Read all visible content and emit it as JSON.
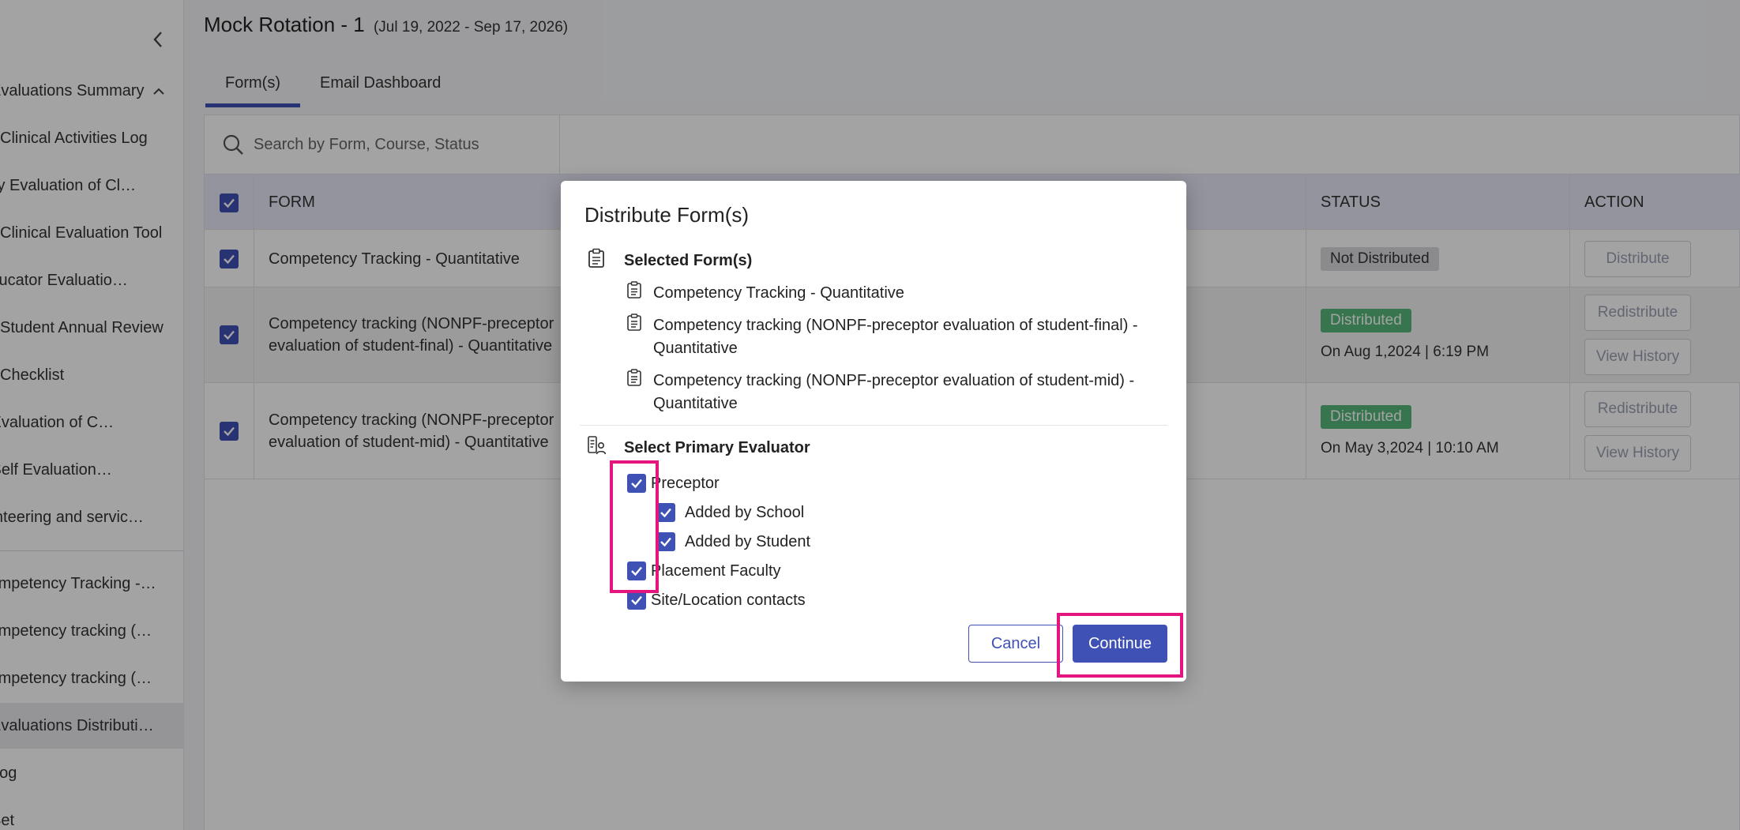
{
  "sidebar": {
    "items": [
      {
        "label": "Evaluations Summary"
      },
      {
        "label": "Clinical Activities Log"
      },
      {
        "label": "Faculty Evaluation of Clinical Site"
      },
      {
        "label": "Clinical Evaluation Tool"
      },
      {
        "label": "Site Educator Evaluation of Student"
      },
      {
        "label": "Student Annual Review"
      },
      {
        "label": "Checklist"
      },
      {
        "label": "Student Evaluation of Course"
      },
      {
        "label": "Student Self Evaluation: Progress"
      },
      {
        "label": "Volunteering and service learning"
      },
      {
        "label": "Competency Tracking - Quantitative"
      },
      {
        "label": "Competency tracking (NONPF-preceptor evaluation of student-final)"
      },
      {
        "label": "Competency tracking (NONPF-preceptor evaluation of student-mid)"
      },
      {
        "label": "Evaluations Distribution"
      },
      {
        "label": "Log"
      },
      {
        "label": "Set"
      }
    ]
  },
  "header": {
    "title": "Mock Rotation - 1",
    "date_range": "(Jul 19, 2022 - Sep 17, 2026)"
  },
  "tabs": [
    {
      "label": "Form(s)"
    },
    {
      "label": "Email Dashboard"
    }
  ],
  "search": {
    "placeholder": "Search by Form, Course, Status"
  },
  "table": {
    "columns": {
      "form": "FORM",
      "status": "STATUS",
      "action": "ACTION"
    },
    "rows": [
      {
        "form": "Competency Tracking - Quantitative",
        "status": "Not Distributed",
        "status_time": "",
        "actions": [
          "Distribute"
        ]
      },
      {
        "form": "Competency tracking (NONPF-preceptor evaluation of student-final) - Quantitative",
        "status": "Distributed",
        "status_time": "On Aug 1,2024 | 6:19 PM",
        "actions": [
          "Redistribute",
          "View History"
        ]
      },
      {
        "form": "Competency tracking (NONPF-preceptor evaluation of student-mid) - Quantitative",
        "status": "Distributed",
        "status_time": "On May 3,2024 | 10:10 AM",
        "actions": [
          "Redistribute",
          "View History"
        ]
      }
    ]
  },
  "modal": {
    "title": "Distribute Form(s)",
    "selected_heading": "Selected Form(s)",
    "forms": [
      "Competency Tracking - Quantitative",
      "Competency tracking (NONPF-preceptor evaluation of student-final) - Quantitative",
      "Competency tracking (NONPF-preceptor evaluation of student-mid) - Quantitative"
    ],
    "evaluator_heading": "Select Primary Evaluator",
    "options": {
      "preceptor": "Preceptor",
      "added_by_school": "Added by School",
      "added_by_student": "Added by Student",
      "placement_faculty": "Placement Faculty",
      "site_contacts": "Site/Location contacts"
    },
    "cancel_label": "Cancel",
    "continue_label": "Continue"
  },
  "colors": {
    "accent": "#3f51b5",
    "highlight": "#e5157f",
    "distributed": "#56b87a"
  }
}
